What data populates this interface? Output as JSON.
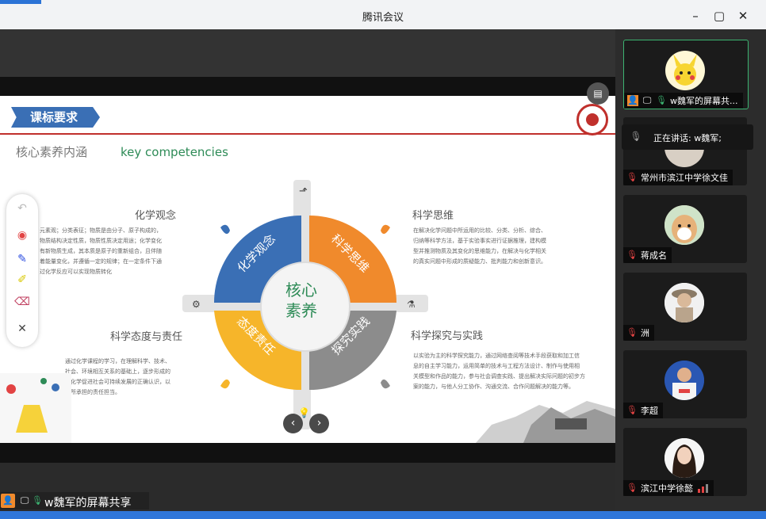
{
  "window": {
    "title": "腾讯会议",
    "minimize": "–",
    "maximize": "▢",
    "close": "✕"
  },
  "slide": {
    "ribbon": "课标要求",
    "subtitle_cn": "核心素养内涵",
    "subtitle_en": "key competencies",
    "center": [
      "核心",
      "素养"
    ],
    "quadrants": [
      "化学观念",
      "科学思维",
      "态度责任",
      "探究实践"
    ],
    "sections": {
      "tl": {
        "title": "化学观念",
        "lines": [
          "元素观；分类表征；物质是由分子、原子构成的，",
          "物质结构决定性质，物质性质决定用途；化学变化",
          "有新物质生成，其本质是原子的重新组合，且伴随",
          "着能量变化，并遵循一定的规律；在一定条件下通",
          "过化学反应可以实现物质转化"
        ]
      },
      "tr": {
        "title": "科学思维",
        "lines": [
          "在解决化学问题中所运用的比较、分类、分析、综合、",
          "归纳等科学方法，基于实验事实进行证据推理，建构模",
          "型并推测物质及其变化的思维能力，在解决与化学相关",
          "的真实问题中形成的质疑能力、批判能力和创新意识。"
        ]
      },
      "bl": {
        "title": "科学态度与责任",
        "lines": [
          "通过化学课程的学习，在理解科学、技术、",
          "社会、环境相互关系的基础上，逐步形成的",
          "对化学促进社会可持续发展的正确认识，以",
          "及所承担的责任担当。"
        ]
      },
      "br": {
        "title": "科学探究与实践",
        "lines": [
          "以实验为主的科学探究能力，通过网络查阅等技术手段获取和加工信",
          "息的自主学习能力，运用简单的技术与工程方法设计、制作与使用相",
          "关模型和作品的能力，参与社会调查实践、提出解决实际问题的初步方",
          "案的能力，与他人分工协作、沟通交流、合作问题解决的能力等。"
        ]
      }
    }
  },
  "toolbar": {
    "undo": "↶",
    "laser": "◉",
    "pen": "✎",
    "highlighter": "✐",
    "eraser": "⌫",
    "close": "✕"
  },
  "nav": {
    "prev": "‹",
    "next": "›",
    "toggle": "▤"
  },
  "share": {
    "label": "w魏军的屏幕共享"
  },
  "speaking": {
    "text": "正在讲话: w魏军;"
  },
  "participants": [
    {
      "name": "w魏军的屏幕共...",
      "avatar": "pikachu",
      "active": true
    },
    {
      "name": "常州市滨江中学徐文佳",
      "avatar": "person"
    },
    {
      "name": "蒋成名",
      "avatar": "dog"
    },
    {
      "name": "洲",
      "avatar": "figure"
    },
    {
      "name": "李超",
      "avatar": "footballer"
    },
    {
      "name": "滨江中学徐懿",
      "avatar": "woman"
    }
  ],
  "colors": {
    "blue": "#3a6fb5",
    "orange": "#f08a2c",
    "yellow": "#f6b52a",
    "gray": "#8c8c8c",
    "green": "#2e8b57",
    "red": "#c0302c"
  }
}
